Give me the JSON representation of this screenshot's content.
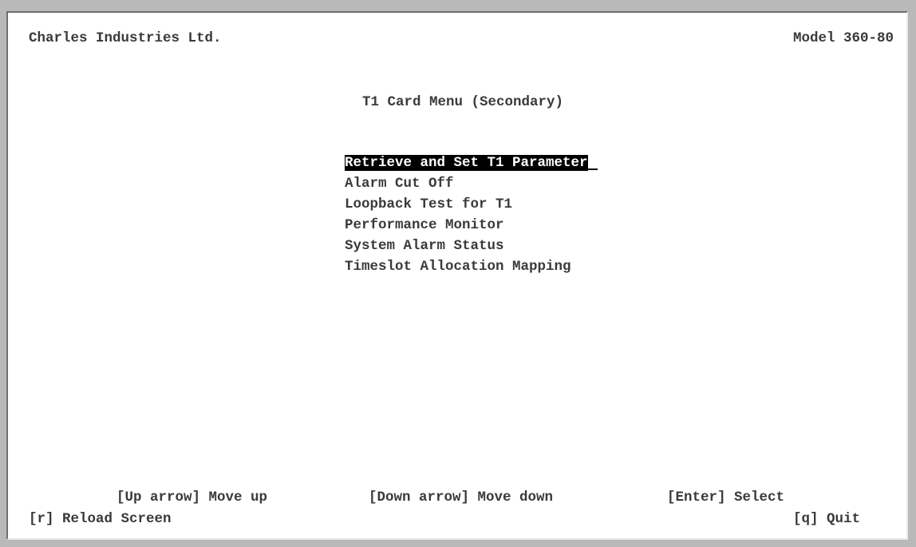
{
  "header": {
    "company": "Charles Industries Ltd.",
    "model": "Model 360-80"
  },
  "title": "T1 Card Menu (Secondary)",
  "menu": {
    "items": [
      {
        "label": "Retrieve and Set T1 Parameter",
        "selected": true
      },
      {
        "label": "Alarm Cut Off"
      },
      {
        "label": "Loopback Test for T1"
      },
      {
        "label": "Performance Monitor"
      },
      {
        "label": "System Alarm Status"
      },
      {
        "label": "Timeslot Allocation Mapping"
      }
    ]
  },
  "footer": {
    "move_up": "[Up arrow] Move up",
    "move_down": "[Down arrow] Move down",
    "select": "[Enter] Select",
    "reload": "[r] Reload Screen",
    "quit": "[q] Quit"
  },
  "colors": {
    "highlight_bg": "#000000",
    "highlight_fg": "#ffffff",
    "text": "#3a3a3a",
    "screen_bg": "#ffffff"
  }
}
